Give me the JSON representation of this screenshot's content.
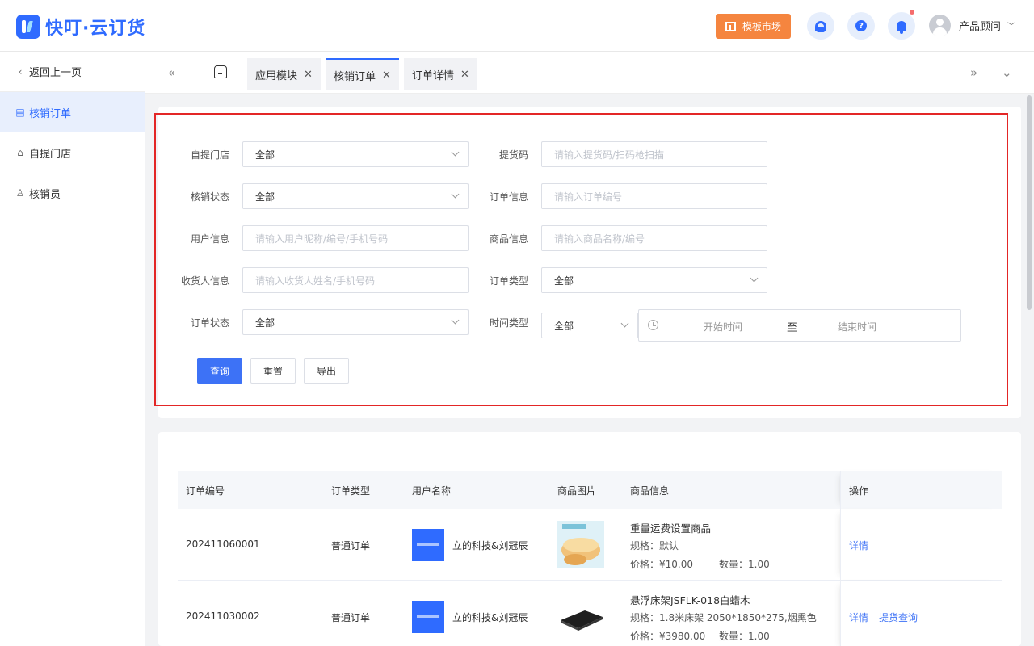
{
  "brand": {
    "name": "快叮·云订货"
  },
  "header": {
    "template_market": "模板市场",
    "user_name": "产品顾问"
  },
  "sidebar": {
    "back": "返回上一页",
    "items": [
      {
        "label": "核销订单",
        "icon": "order-icon",
        "active": true
      },
      {
        "label": "自提门店",
        "icon": "store-icon",
        "active": false
      },
      {
        "label": "核销员",
        "icon": "person-icon",
        "active": false
      }
    ]
  },
  "tabs": [
    {
      "label": "应用模块"
    },
    {
      "label": "核销订单",
      "active": true
    },
    {
      "label": "订单详情"
    }
  ],
  "filters": {
    "store": {
      "label": "自提门店",
      "value": "全部"
    },
    "pickup_code": {
      "label": "提货码",
      "placeholder": "请输入提货码/扫码枪扫描"
    },
    "verify_status": {
      "label": "核销状态",
      "value": "全部"
    },
    "order_info": {
      "label": "订单信息",
      "placeholder": "请输入订单编号"
    },
    "user_info": {
      "label": "用户信息",
      "placeholder": "请输入用户昵称/编号/手机号码"
    },
    "goods_info": {
      "label": "商品信息",
      "placeholder": "请输入商品名称/编号"
    },
    "receiver_info": {
      "label": "收货人信息",
      "placeholder": "请输入收货人姓名/手机号码"
    },
    "order_type": {
      "label": "订单类型",
      "value": "全部"
    },
    "order_status": {
      "label": "订单状态",
      "value": "全部"
    },
    "time_type": {
      "label": "时间类型",
      "value": "全部"
    },
    "start_time": "开始时间",
    "range_sep": "至",
    "end_time": "结束时间",
    "buttons": {
      "query": "查询",
      "reset": "重置",
      "export": "导出"
    }
  },
  "table": {
    "columns": [
      "订单编号",
      "订单类型",
      "用户名称",
      "商品图片",
      "商品信息",
      "操作"
    ],
    "rows": [
      {
        "order_no": "202411060001",
        "order_type": "普通订单",
        "user_name": "立的科技&刘冠辰",
        "goods_name": "重量运费设置商品",
        "spec": "规格：默认",
        "price": "价格：¥10.00",
        "qty": "数量：1.00",
        "actions": [
          "详情"
        ]
      },
      {
        "order_no": "202411030002",
        "order_type": "普通订单",
        "user_name": "立的科技&刘冠辰",
        "goods_name": "悬浮床架JSFLK-018白蜡木",
        "spec": "规格：1.8米床架 2050*1850*275,烟熏色",
        "price": "价格：¥3980.00",
        "qty": "数量：1.00",
        "actions": [
          "详情",
          "提货查询"
        ]
      }
    ]
  }
}
